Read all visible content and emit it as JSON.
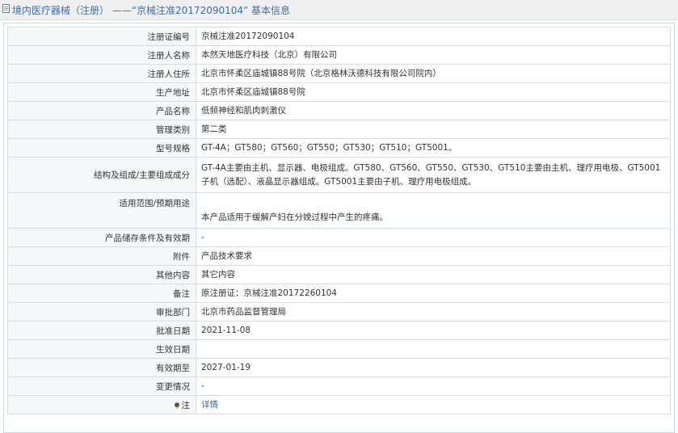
{
  "header": {
    "title": "境内医疗器械（注册） ——“京械注准20172090104” 基本信息"
  },
  "rows": [
    {
      "label": "注册证编号",
      "value": "京械注准20172090104"
    },
    {
      "label": "注册人名称",
      "value": "本然天地医疗科技（北京）有限公司"
    },
    {
      "label": "注册人住所",
      "value": "北京市怀柔区庙城镇88号院（北京格林沃德科技有限公司院内）"
    },
    {
      "label": "生产地址",
      "value": "北京市怀柔区庙城镇88号院"
    },
    {
      "label": "产品名称",
      "value": "低频神经和肌肉刺激仪"
    },
    {
      "label": "管理类别",
      "value": "第二类"
    },
    {
      "label": "型号规格",
      "value": "GT-4A；GT580；GT560；GT550；GT530；GT510；GT5001。"
    },
    {
      "label": "结构及组成/主要组成成分",
      "value": "GT-4A主要由主机、显示器、电极组成。GT580、GT560、GT550、GT530、GT510主要由主机、理疗用电极、GT5001子机（选配）、液晶显示器组成。GT5001主要由子机、理疗用电极组成。"
    },
    {
      "label": "适用范围/预期用途",
      "value": "本产品适用于缓解产妇在分娩过程中产生的疼痛。"
    },
    {
      "label": "产品储存条件及有效期",
      "value": "-"
    },
    {
      "label": "附件",
      "value": "产品技术要求"
    },
    {
      "label": "其他内容",
      "value": "其它内容"
    },
    {
      "label": "备注",
      "value": "原注册证：京械注准20172260104"
    },
    {
      "label": "审批部门",
      "value": "北京市药品监督管理局"
    },
    {
      "label": "批准日期",
      "value": "2021-11-08"
    },
    {
      "label": "生效日期",
      "value": ""
    },
    {
      "label": "有效期至",
      "value": "2027-01-19"
    },
    {
      "label": "变更情况",
      "value": "-"
    }
  ],
  "note": {
    "label": "注",
    "link": "详情",
    "icon": "bulb-icon"
  },
  "colors": {
    "link": "#2a65c4",
    "title": "#3a6fb0",
    "label_bg": "#f6f7f9",
    "border": "#d4dce6"
  }
}
